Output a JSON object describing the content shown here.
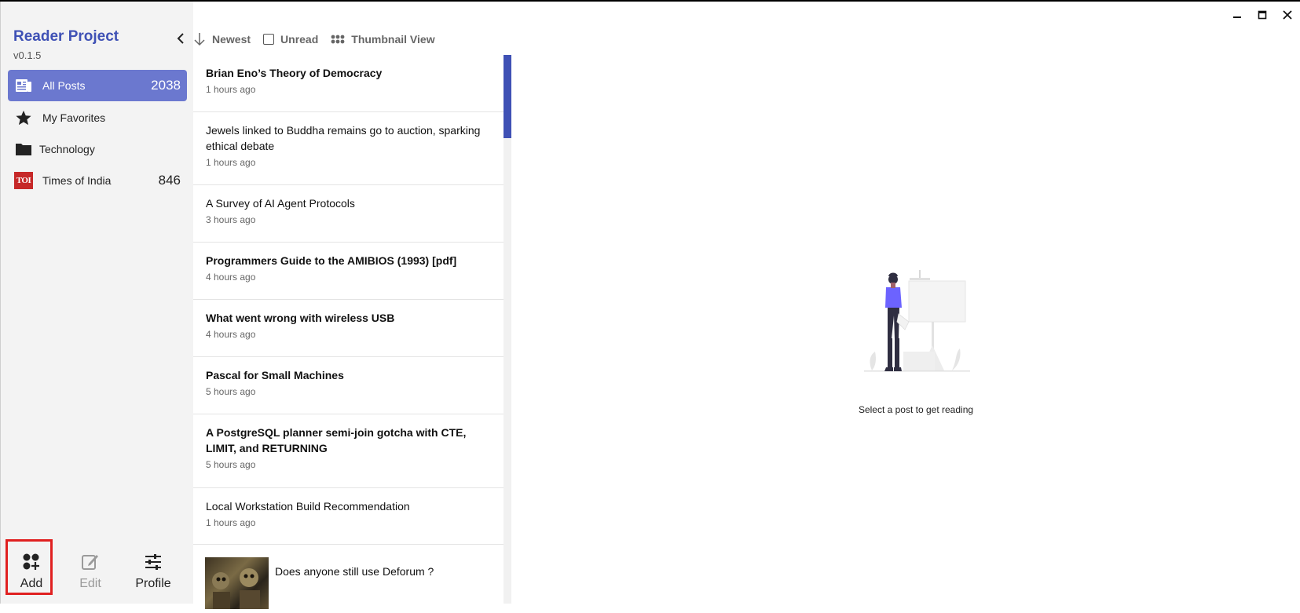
{
  "window": {
    "minimize_icon": "minimize-icon",
    "maximize_icon": "maximize-icon",
    "close_icon": "close-icon"
  },
  "sidebar": {
    "title": "Reader Project",
    "version": "v0.1.5",
    "items": [
      {
        "label": "All Posts",
        "count": "2038",
        "icon": "newspaper-icon",
        "active": true
      },
      {
        "label": "My Favorites",
        "count": "",
        "icon": "star-icon",
        "active": false
      },
      {
        "label": "Technology",
        "count": "",
        "icon": "folder-icon",
        "active": false
      },
      {
        "label": "Times of India",
        "count": "846",
        "icon": "toi-logo-icon",
        "icon_text": "TOI",
        "active": false
      }
    ],
    "bottom": {
      "add_label": "Add",
      "edit_label": "Edit",
      "profile_label": "Profile"
    }
  },
  "toolbar": {
    "sort_label": "Newest",
    "unread_label": "Unread",
    "view_label": "Thumbnail View"
  },
  "posts": [
    {
      "title": "Brian Eno’s Theory of Democracy",
      "time": "1 hours ago",
      "unread": true
    },
    {
      "title": "Jewels linked to Buddha remains go to auction, sparking ethical debate",
      "time": "1 hours ago",
      "unread": false
    },
    {
      "title": "A Survey of AI Agent Protocols",
      "time": "3 hours ago",
      "unread": false
    },
    {
      "title": "Programmers Guide to the AMIBIOS (1993) [pdf]",
      "time": "4 hours ago",
      "unread": true
    },
    {
      "title": "What went wrong with wireless USB",
      "time": "4 hours ago",
      "unread": true
    },
    {
      "title": "Pascal for Small Machines",
      "time": "5 hours ago",
      "unread": true
    },
    {
      "title": "A PostgreSQL planner semi-join gotcha with CTE, LIMIT, and RETURNING",
      "time": "5 hours ago",
      "unread": true
    },
    {
      "title": "Local Workstation Build Recommendation",
      "time": "1 hours ago",
      "unread": false
    },
    {
      "title": "Does anyone still use Deforum ?",
      "time": "",
      "unread": false
    }
  ],
  "reading_pane": {
    "empty_message": "Select a post to get reading"
  },
  "colors": {
    "accent": "#3f51b5",
    "active_nav": "#6b78cf",
    "highlight": "#e02020",
    "illustration_accent": "#6c63ff"
  }
}
